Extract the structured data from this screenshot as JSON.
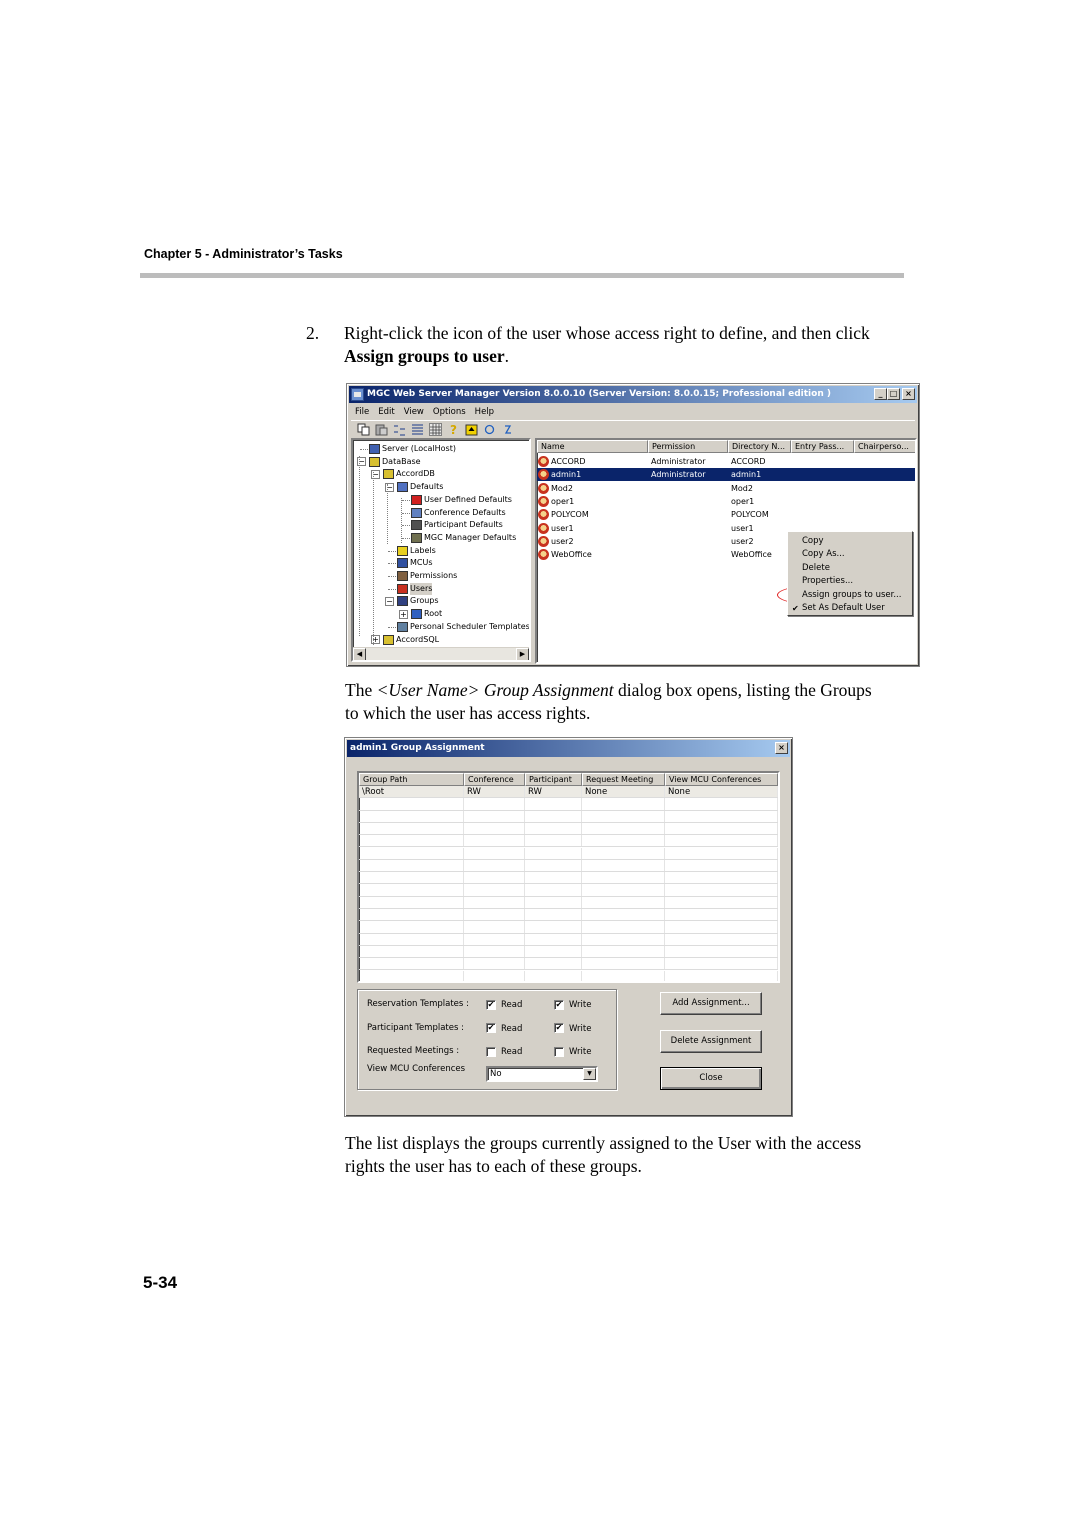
{
  "page": {
    "chapter_header": "Chapter 5 - Administrator’s Tasks",
    "step_number": "2.",
    "step_text_before": "Right-click the icon of the user whose access right to define, and then click ",
    "step_text_bold": "Assign groups to user",
    "step_text_after": ".",
    "para1_before": "The ",
    "para1_italic": "<User Name> Group Assignment",
    "para1_after": " dialog box opens, listing the Groups to which the user has access rights.",
    "para2": "The list displays the groups currently assigned to the User with the access rights the user has to each of these groups.",
    "page_number": "5-34"
  },
  "manager_window": {
    "title": "MGC Web Server Manager Version 8.0.0.10 (Server Version: 8.0.0.15;  Professional edition )",
    "title_buttons": [
      "_",
      "□",
      "×"
    ],
    "menu": [
      "File",
      "Edit",
      "View",
      "Options",
      "Help"
    ],
    "toolbar_icons": [
      "copy-icon",
      "paste-icon",
      "list-icon",
      "details-icon",
      "grid-icon",
      "help-icon",
      "up-folder-icon",
      "refresh-icon",
      "reconnect-icon"
    ],
    "tree": [
      {
        "label": "Server (LocalHost)",
        "icon": "server-icon",
        "level": 0
      },
      {
        "label": "DataBase",
        "icon": "database-icon",
        "level": 0,
        "expander": "−"
      },
      {
        "label": "AccordDB",
        "icon": "database-icon",
        "level": 1,
        "expander": "−"
      },
      {
        "label": "Defaults",
        "icon": "defaults-icon",
        "level": 2,
        "expander": "−"
      },
      {
        "label": "User Defined Defaults",
        "icon": "user-defaults-icon",
        "level": 3
      },
      {
        "label": "Conference Defaults",
        "icon": "conference-icon",
        "level": 3
      },
      {
        "label": "Participant Defaults",
        "icon": "participant-icon",
        "level": 3
      },
      {
        "label": "MGC Manager Defaults",
        "icon": "manager-icon",
        "level": 3
      },
      {
        "label": "Labels",
        "icon": "labels-icon",
        "level": 2
      },
      {
        "label": "MCUs",
        "icon": "mcu-icon",
        "level": 2
      },
      {
        "label": "Permissions",
        "icon": "permissions-icon",
        "level": 2
      },
      {
        "label": "Users",
        "icon": "users-icon",
        "level": 2,
        "selected": true
      },
      {
        "label": "Groups",
        "icon": "groups-icon",
        "level": 2,
        "expander": "−"
      },
      {
        "label": "Root",
        "icon": "root-group-icon",
        "level": 3,
        "expander": "+"
      },
      {
        "label": "Personal Scheduler Templates",
        "icon": "templates-icon",
        "level": 2
      },
      {
        "label": "AccordSQL",
        "icon": "database-icon",
        "level": 1,
        "expander": "+"
      }
    ],
    "list_columns": [
      "Name",
      "Permission",
      "Directory N...",
      "Entry Pass...",
      "Chairperso..."
    ],
    "users": [
      {
        "name": "ACCORD",
        "permission": "Administrator",
        "directory": "ACCORD"
      },
      {
        "name": "admin1",
        "permission": "Administrator",
        "directory": "admin1",
        "selected": true
      },
      {
        "name": "Mod2",
        "permission": "",
        "directory": "Mod2"
      },
      {
        "name": "oper1",
        "permission": "",
        "directory": "oper1"
      },
      {
        "name": "POLYCOM",
        "permission": "",
        "directory": "POLYCOM"
      },
      {
        "name": "user1",
        "permission": "",
        "directory": "user1"
      },
      {
        "name": "user2",
        "permission": "",
        "directory": "user2"
      },
      {
        "name": "WebOffice",
        "permission": "",
        "directory": "WebOffice"
      }
    ],
    "context_menu": [
      {
        "label": "Copy"
      },
      {
        "label": "Copy As..."
      },
      {
        "label": "Delete"
      },
      {
        "label": "Properties..."
      },
      {
        "label": "Assign groups to user...",
        "highlighted_annotation": true
      },
      {
        "label": "Set As Default User",
        "checked": true
      }
    ],
    "annotation_color": "#e02020"
  },
  "assignment_dialog": {
    "title": "admin1 Group Assignment",
    "close_glyph": "×",
    "columns": [
      "Group Path",
      "Conference",
      "Participant",
      "Request Meeting",
      "View MCU Conferences"
    ],
    "rows": [
      [
        "\\Root",
        "RW",
        "RW",
        "None",
        "None"
      ]
    ],
    "permissions": [
      {
        "label": "Reservation Templates :",
        "read": true,
        "write": true
      },
      {
        "label": "Participant Templates  :",
        "read": true,
        "write": true
      },
      {
        "label": "Requested Meetings   :",
        "read": false,
        "write": false
      }
    ],
    "read_label": "Read",
    "write_label": "Write",
    "view_mcu_label": "View MCU Conferences",
    "view_mcu_value": "No",
    "buttons": {
      "add": "Add Assignment...",
      "delete": "Delete Assignment",
      "close": "Close"
    }
  }
}
